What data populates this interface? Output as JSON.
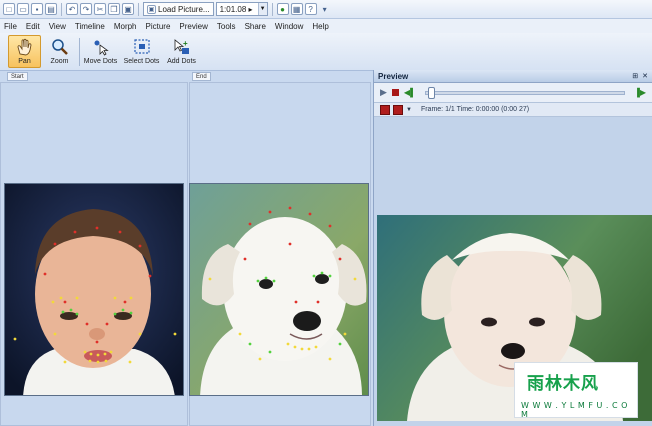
{
  "toolbar": {
    "load_picture_label": "Load Picture...",
    "zoom_value": "1:01.08 ▸"
  },
  "menu": [
    "File",
    "Edit",
    "View",
    "Timeline",
    "Morph",
    "Picture",
    "Preview",
    "Tools",
    "Share",
    "Window",
    "Help"
  ],
  "tools": [
    {
      "label": "Pan",
      "icon": "hand-icon",
      "active": true
    },
    {
      "label": "Zoom",
      "icon": "magnifier-icon",
      "active": false
    },
    {
      "label": "Move Dots",
      "icon": "move-dots-icon",
      "active": false
    },
    {
      "label": "Select Dots",
      "icon": "select-dots-icon",
      "active": false
    },
    {
      "label": "Add Dots",
      "icon": "add-dots-icon",
      "active": false
    }
  ],
  "group_labels": {
    "start": "Start",
    "end": "End"
  },
  "preview": {
    "title": "Preview",
    "frame_info": "Frame: 1/1 Time: 0:00:00 (0:00 27)"
  },
  "watermark": {
    "text": "雨林木风",
    "url": "W W W . Y L M F U . C O M"
  },
  "colors": {
    "accent_active": "#f7c25e",
    "workspace_bg": "#c8d8ee",
    "dot_red": "#e0302a",
    "dot_yellow": "#f2d93a",
    "dot_green": "#54d23f",
    "watermark_green": "#17a14c"
  }
}
